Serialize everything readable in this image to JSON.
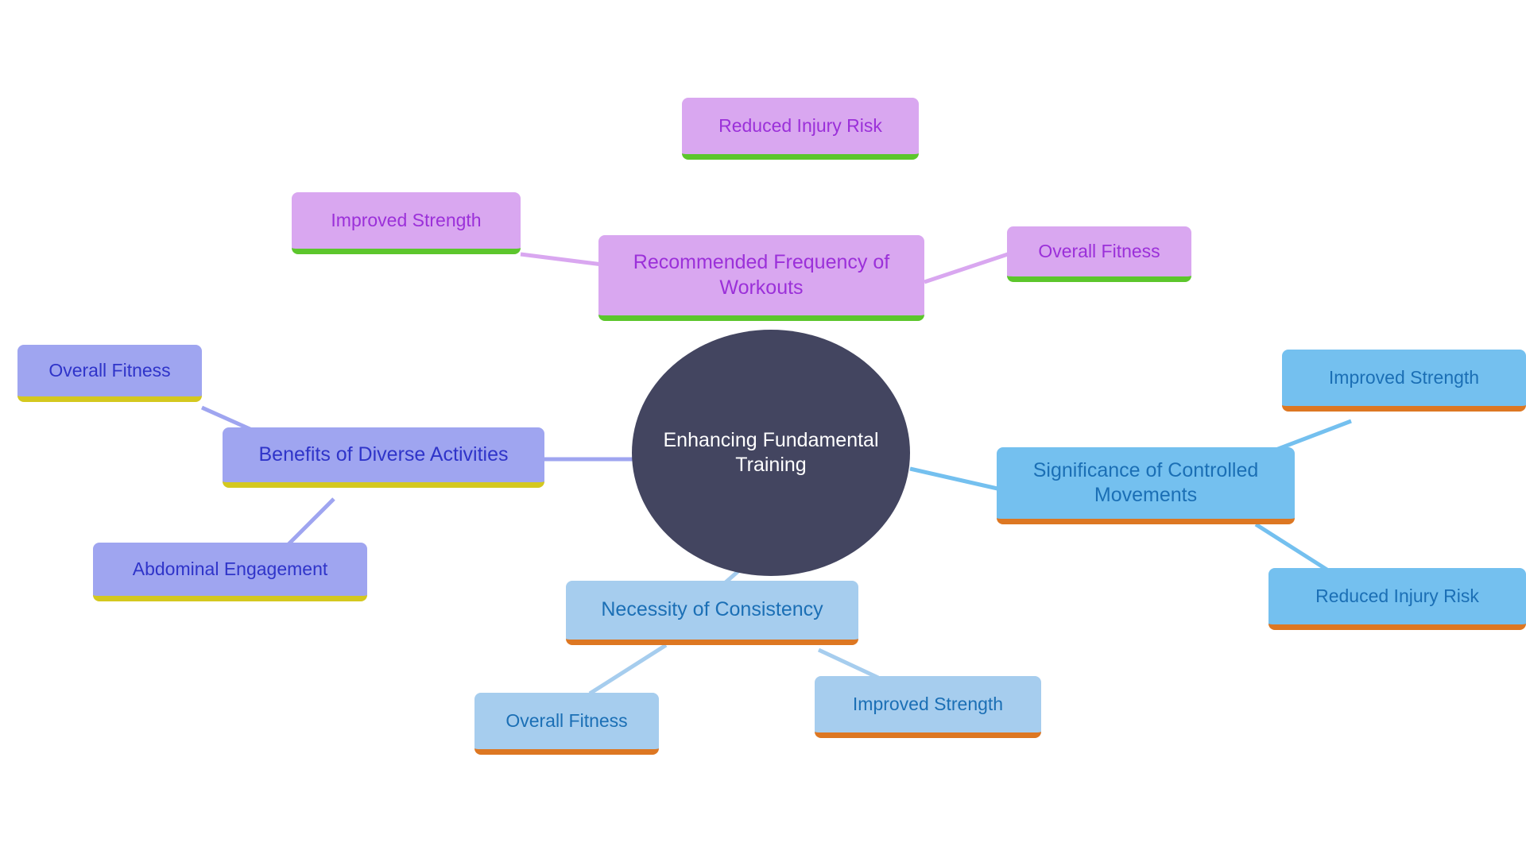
{
  "diagram": {
    "type": "mind-map",
    "title": "Enhancing Fundamental Training",
    "background": "#ffffff",
    "palette": {
      "root_fill": "#434560",
      "root_text": "#ffffff",
      "purple_fill": "#d9a7f0",
      "purple_text": "#9b30d9",
      "purple_accent": "#5cc62c",
      "periwinkle_fill": "#9fa5f0",
      "periwinkle_text": "#2f34c9",
      "periwinkle_accent": "#d4c81f",
      "skyblue_fill": "#74c0ef",
      "skyblue_text": "#1b6fb5",
      "skyblue_accent": "#dd7722",
      "lightblue_fill": "#a6cdee",
      "lightblue_text": "#1b6fb5",
      "lightblue_accent": "#dd7722"
    }
  },
  "nodes": {
    "root": {
      "label": "Enhancing Fundamental\nTraining"
    },
    "branch_frequency": {
      "label": "Recommended Frequency of\nWorkouts"
    },
    "leaf_reduced_injury_top": {
      "label": "Reduced Injury Risk"
    },
    "leaf_improved_strength_topleft": {
      "label": "Improved Strength"
    },
    "leaf_overall_fitness_topright": {
      "label": "Overall Fitness"
    },
    "branch_diverse": {
      "label": "Benefits of Diverse Activities"
    },
    "leaf_overall_fitness_left": {
      "label": "Overall Fitness"
    },
    "leaf_abdominal": {
      "label": "Abdominal Engagement"
    },
    "branch_controlled": {
      "label": "Significance of Controlled\nMovements"
    },
    "leaf_improved_strength_right": {
      "label": "Improved Strength"
    },
    "leaf_reduced_injury_right": {
      "label": "Reduced Injury Risk"
    },
    "branch_consistency": {
      "label": "Necessity of Consistency"
    },
    "leaf_overall_fitness_bottom": {
      "label": "Overall Fitness"
    },
    "leaf_improved_strength_bottom": {
      "label": "Improved Strength"
    }
  }
}
